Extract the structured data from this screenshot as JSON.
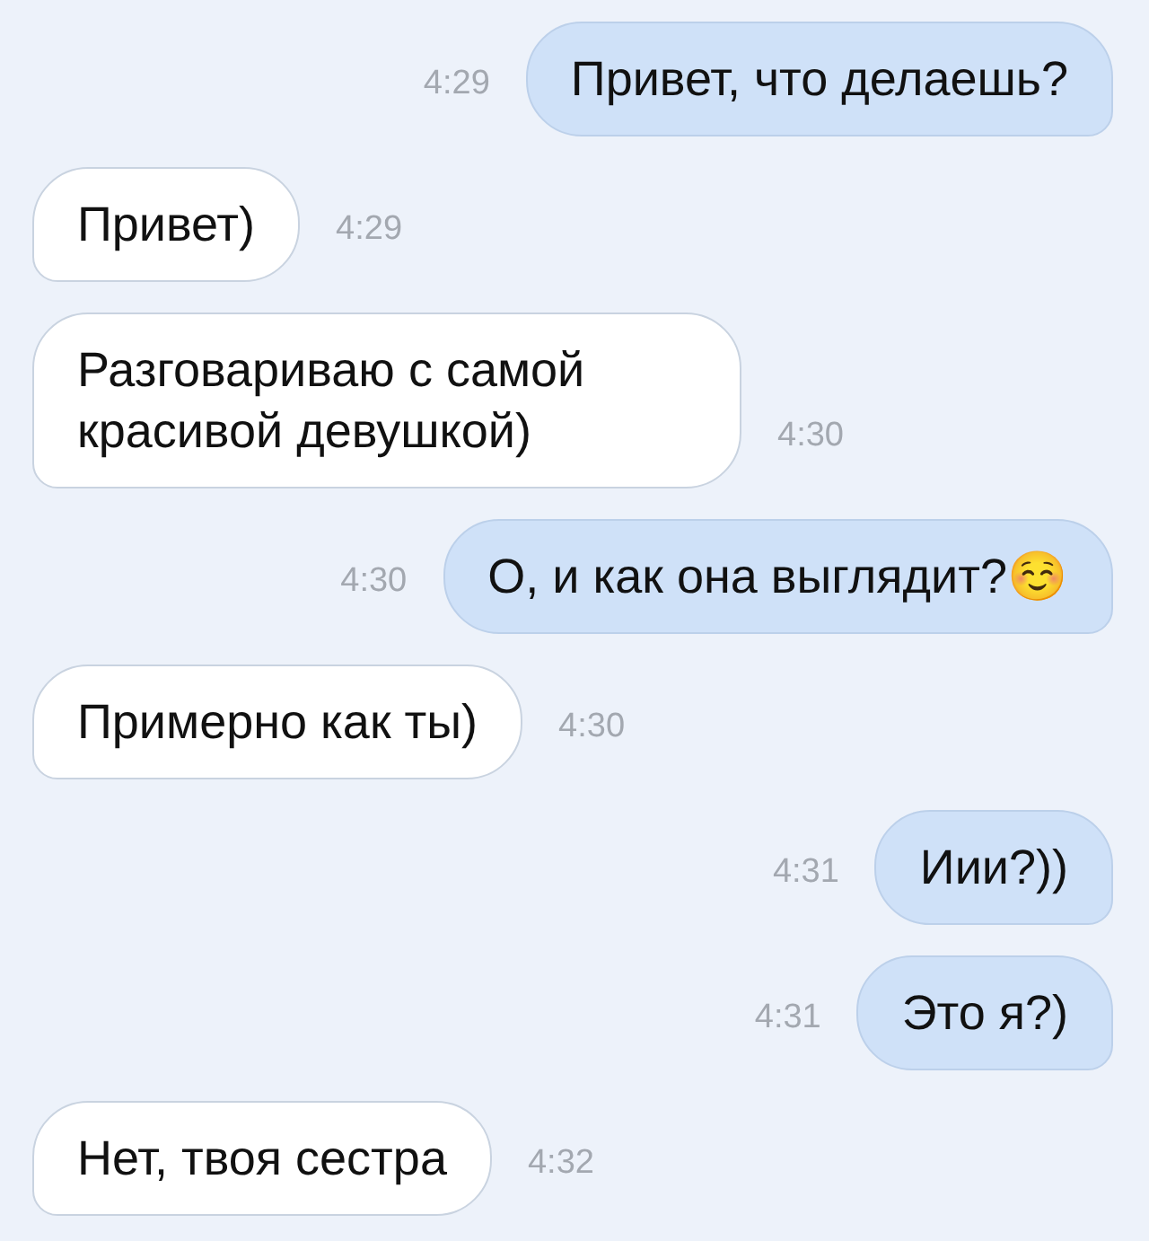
{
  "messages": [
    {
      "kind": "outgoing",
      "text": "Привет, что делаешь?",
      "time": "4:29"
    },
    {
      "kind": "incoming",
      "text": "Привет)",
      "time": "4:29"
    },
    {
      "kind": "incoming",
      "text": "Разговариваю с самой красивой девушкой)",
      "time": "4:30"
    },
    {
      "kind": "outgoing",
      "text": "О, и как она выглядит?☺️",
      "time": "4:30"
    },
    {
      "kind": "incoming",
      "text": "Примерно как ты)",
      "time": "4:30"
    },
    {
      "kind": "outgoing",
      "text": "Иии?))",
      "time": "4:31"
    },
    {
      "kind": "outgoing",
      "text": "Это я?)",
      "time": "4:31"
    },
    {
      "kind": "incoming",
      "text": "Нет, твоя сестра",
      "time": "4:32"
    }
  ]
}
